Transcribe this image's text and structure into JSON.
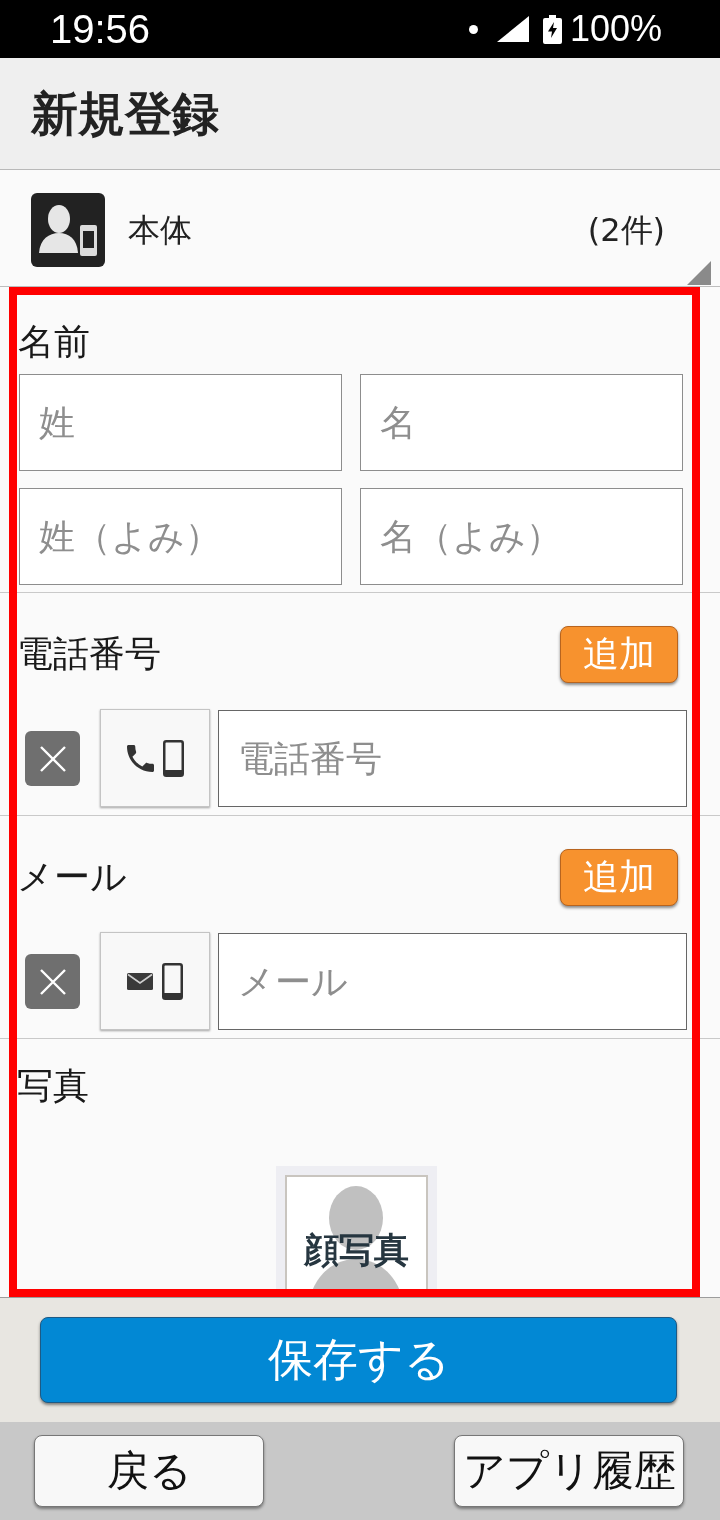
{
  "status_bar": {
    "time": "19:56",
    "battery": "100%"
  },
  "header": {
    "title": "新規登録"
  },
  "account": {
    "name": "本体",
    "count": "(2件)"
  },
  "sections": [
    {
      "kind": "name",
      "label": "名前",
      "fields": [
        {
          "placeholder": "姓"
        },
        {
          "placeholder": "名"
        },
        {
          "placeholder": "姓（よみ）"
        },
        {
          "placeholder": "名（よみ）"
        }
      ]
    },
    {
      "kind": "entries",
      "label": "電話番号",
      "add_button": "追加",
      "entries": [
        {
          "kind": "phone",
          "placeholder": "電話番号"
        }
      ]
    },
    {
      "kind": "entries",
      "label": "メール",
      "add_button": "追加",
      "entries": [
        {
          "kind": "mail",
          "placeholder": "メール"
        }
      ]
    },
    {
      "kind": "photo",
      "label": "写真",
      "photo_label": "顔写真"
    }
  ],
  "save_button": "保存する",
  "nav_buttons": [
    "戻る",
    "アプリ履歴"
  ]
}
